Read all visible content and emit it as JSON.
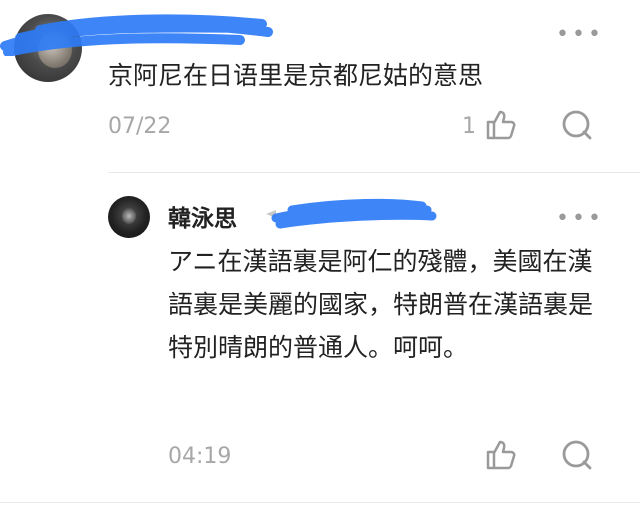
{
  "comment": {
    "text": "京阿尼在日语里是京都尼姑的意思",
    "date": "07/22",
    "like_count": "1",
    "more_label": "•••"
  },
  "reply": {
    "author": "韓泳思",
    "text": "アニ在漢語裏是阿仁的殘體，美國在漢語裏是美麗的國家，特朗普在漢語裏是特別晴朗的普通人。呵呵。",
    "time": "04:19",
    "more_label": "•••"
  },
  "colors": {
    "redaction_blue": "#2e7cf6",
    "meta_gray": "#a7a7a7",
    "divider": "#e9e9e9"
  },
  "icons": [
    "thumbs-up-icon",
    "comment-bubble-icon",
    "more-options-icon"
  ]
}
